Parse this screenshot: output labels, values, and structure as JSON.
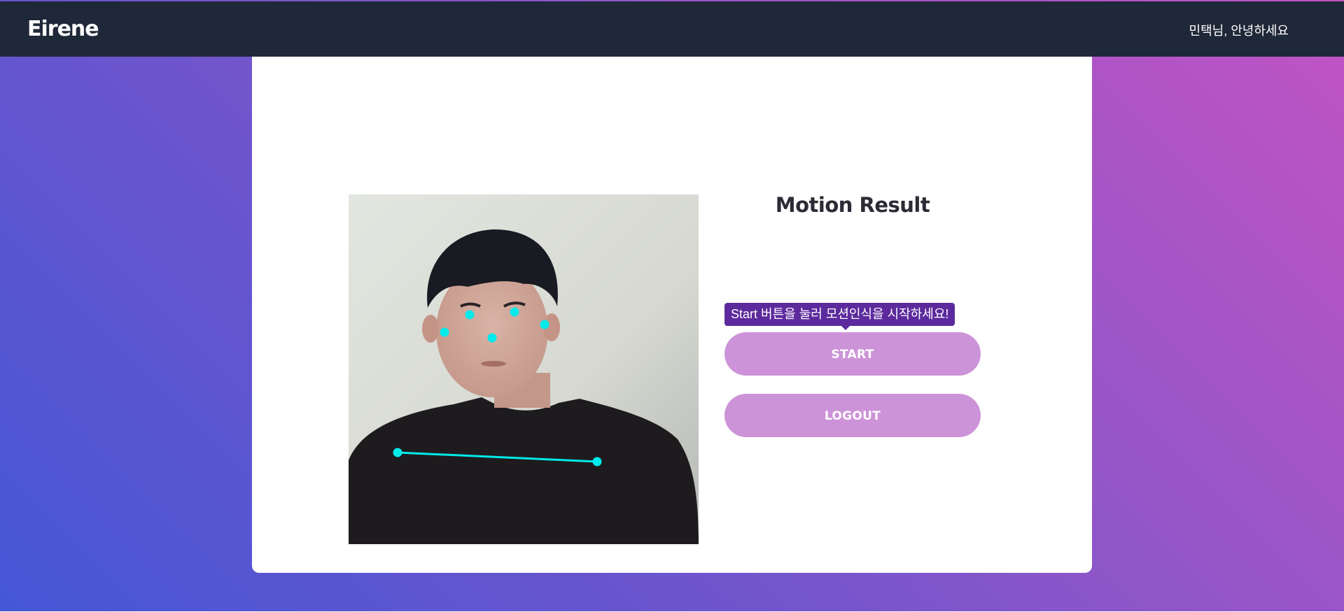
{
  "navbar": {
    "brand": "Eirene",
    "greeting": "민택님, 안녕하세요"
  },
  "main": {
    "webcam": {
      "overlay_color": "#00f0f0"
    },
    "result_title": "Motion Result",
    "tooltip": "Start 버튼을 눌러 모션인식을 시작하세요!",
    "buttons": {
      "start": "START",
      "logout": "LOGOUT"
    }
  },
  "colors": {
    "navbar_bg": "#1f2838",
    "button_bg": "#cd93d8",
    "tooltip_bg": "#5c2a9d",
    "gradient_start": "#4557d6",
    "gradient_end": "#c253c4"
  }
}
